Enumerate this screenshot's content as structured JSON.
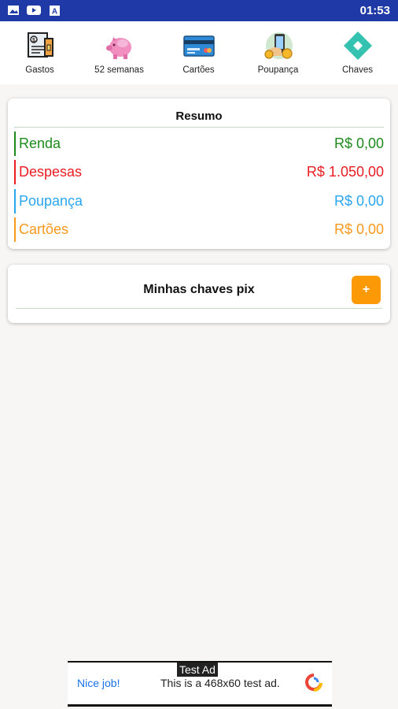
{
  "status_bar": {
    "time": "01:53",
    "icons": [
      "image-icon",
      "play-icon",
      "font-icon"
    ]
  },
  "nav": {
    "items": [
      {
        "label": "Gastos",
        "icon": "receipt-icon"
      },
      {
        "label": "52 semanas",
        "icon": "piggy-bank-icon"
      },
      {
        "label": "Cartões",
        "icon": "credit-card-icon"
      },
      {
        "label": "Poupança",
        "icon": "savings-icon"
      },
      {
        "label": "Chaves",
        "icon": "pix-icon"
      }
    ]
  },
  "summary": {
    "title": "Resumo",
    "rows": [
      {
        "name": "Renda",
        "value": "R$ 0,00",
        "color": "#1e8a1e"
      },
      {
        "name": "Despesas",
        "value": "R$ 1.050,00",
        "color": "#ea1c24"
      },
      {
        "name": "Poupança",
        "value": "R$ 0,00",
        "color": "#2aa6ee"
      },
      {
        "name": "Cartões",
        "value": "R$ 0,00",
        "color": "#f8981d"
      }
    ]
  },
  "pix": {
    "title": "Minhas chaves pix",
    "add_label": "+"
  },
  "ad": {
    "badge": "Test Ad",
    "cta": "Nice job!",
    "text": "This is a 468x60 test ad."
  },
  "colors": {
    "status_bar": "#1f3aa6",
    "accent": "#fb9a06",
    "pix_teal": "#33c2b0"
  }
}
